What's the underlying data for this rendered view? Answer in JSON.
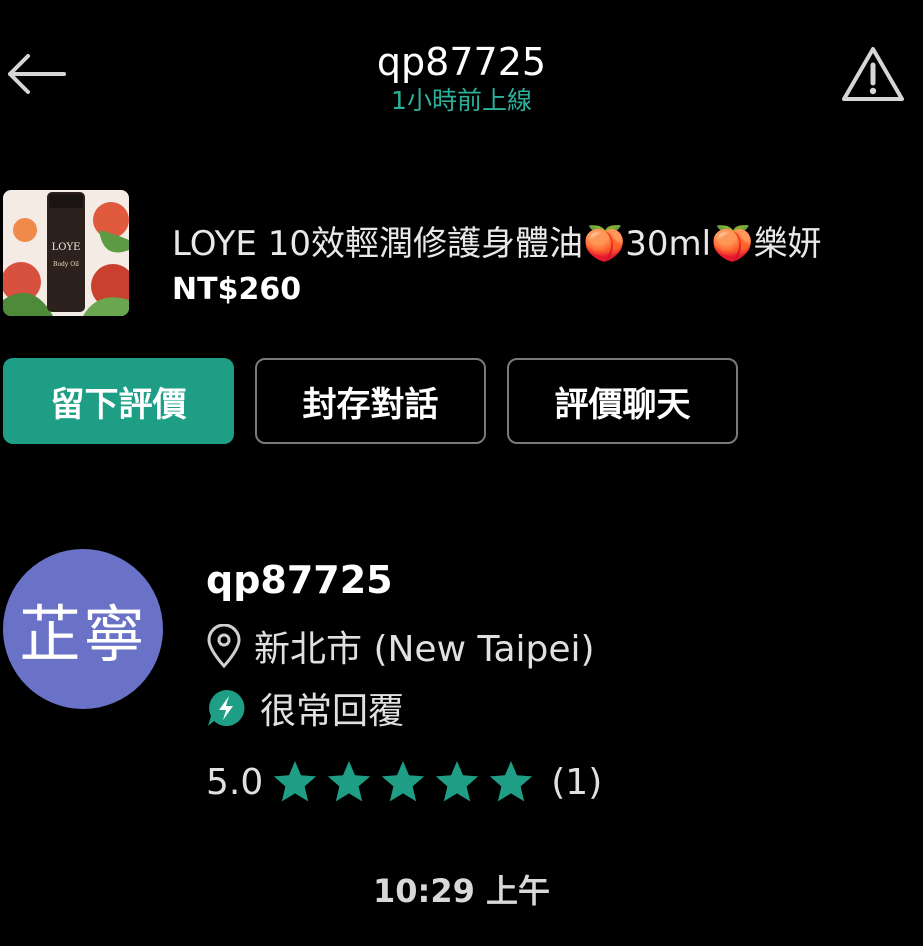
{
  "header": {
    "username": "qp87725",
    "status": "1小時前上線"
  },
  "listing": {
    "title": "LOYE 10效輕潤修護身體油🍑30ml🍑樂妍",
    "price": "NT$260",
    "thumb_label_brand": "LOYE",
    "thumb_label_sub": "Body Oil"
  },
  "actions": {
    "leave_review": "留下評價",
    "archive_chat": "封存對話",
    "rate_chat": "評價聊天"
  },
  "profile": {
    "avatar_text": "芷寧",
    "avatar_color": "#6a72c7",
    "name": "qp87725",
    "location": "新北市 (New Taipei)",
    "reply_badge": "很常回覆",
    "rating": "5.0",
    "stars": 5,
    "review_count": "(1)"
  },
  "chat": {
    "timestamp": "10:29 上午"
  },
  "colors": {
    "accent": "#1f9e86",
    "status_text": "#2bb09b",
    "star": "#1f9e86"
  }
}
